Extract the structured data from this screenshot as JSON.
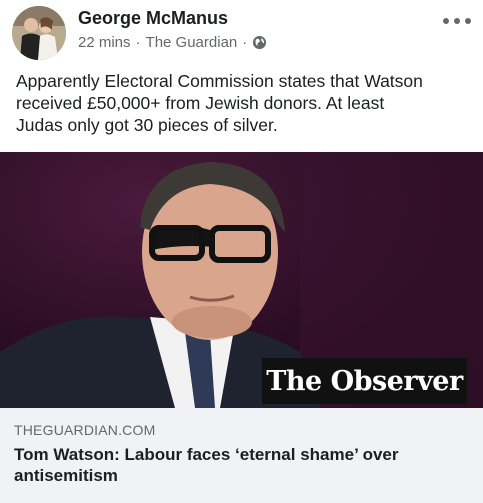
{
  "post": {
    "author": "George McManus",
    "time": "22 mins",
    "separator": "·",
    "source": "The Guardian",
    "text": "Apparently Electoral Commission states that Watson\nreceived £50,000+ from Jewish donors.   At least\nJudas only got 30 pieces of silver."
  },
  "link": {
    "logo_text": "The Observer",
    "domain": "THEGUARDIAN.COM",
    "title": "Tom Watson: Labour faces ‘eternal shame’ over antisemitism"
  },
  "icons": {
    "avatar": "avatar",
    "globe": "globe-icon",
    "more": "more-options-icon"
  }
}
